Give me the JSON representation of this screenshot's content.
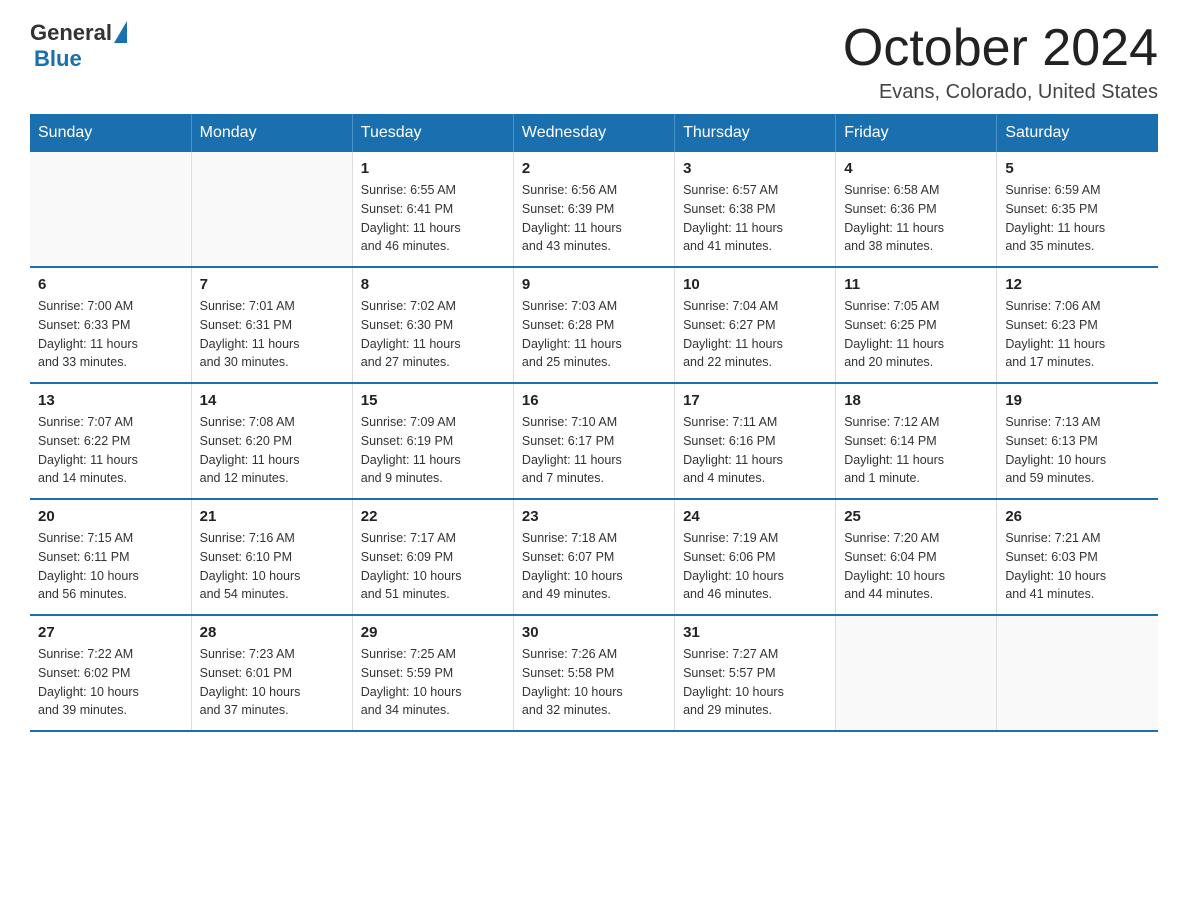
{
  "logo": {
    "general": "General",
    "triangle": "▶",
    "blue": "Blue"
  },
  "header": {
    "title": "October 2024",
    "location": "Evans, Colorado, United States"
  },
  "days_of_week": [
    "Sunday",
    "Monday",
    "Tuesday",
    "Wednesday",
    "Thursday",
    "Friday",
    "Saturday"
  ],
  "weeks": [
    [
      {
        "day": "",
        "info": ""
      },
      {
        "day": "",
        "info": ""
      },
      {
        "day": "1",
        "info": "Sunrise: 6:55 AM\nSunset: 6:41 PM\nDaylight: 11 hours\nand 46 minutes."
      },
      {
        "day": "2",
        "info": "Sunrise: 6:56 AM\nSunset: 6:39 PM\nDaylight: 11 hours\nand 43 minutes."
      },
      {
        "day": "3",
        "info": "Sunrise: 6:57 AM\nSunset: 6:38 PM\nDaylight: 11 hours\nand 41 minutes."
      },
      {
        "day": "4",
        "info": "Sunrise: 6:58 AM\nSunset: 6:36 PM\nDaylight: 11 hours\nand 38 minutes."
      },
      {
        "day": "5",
        "info": "Sunrise: 6:59 AM\nSunset: 6:35 PM\nDaylight: 11 hours\nand 35 minutes."
      }
    ],
    [
      {
        "day": "6",
        "info": "Sunrise: 7:00 AM\nSunset: 6:33 PM\nDaylight: 11 hours\nand 33 minutes."
      },
      {
        "day": "7",
        "info": "Sunrise: 7:01 AM\nSunset: 6:31 PM\nDaylight: 11 hours\nand 30 minutes."
      },
      {
        "day": "8",
        "info": "Sunrise: 7:02 AM\nSunset: 6:30 PM\nDaylight: 11 hours\nand 27 minutes."
      },
      {
        "day": "9",
        "info": "Sunrise: 7:03 AM\nSunset: 6:28 PM\nDaylight: 11 hours\nand 25 minutes."
      },
      {
        "day": "10",
        "info": "Sunrise: 7:04 AM\nSunset: 6:27 PM\nDaylight: 11 hours\nand 22 minutes."
      },
      {
        "day": "11",
        "info": "Sunrise: 7:05 AM\nSunset: 6:25 PM\nDaylight: 11 hours\nand 20 minutes."
      },
      {
        "day": "12",
        "info": "Sunrise: 7:06 AM\nSunset: 6:23 PM\nDaylight: 11 hours\nand 17 minutes."
      }
    ],
    [
      {
        "day": "13",
        "info": "Sunrise: 7:07 AM\nSunset: 6:22 PM\nDaylight: 11 hours\nand 14 minutes."
      },
      {
        "day": "14",
        "info": "Sunrise: 7:08 AM\nSunset: 6:20 PM\nDaylight: 11 hours\nand 12 minutes."
      },
      {
        "day": "15",
        "info": "Sunrise: 7:09 AM\nSunset: 6:19 PM\nDaylight: 11 hours\nand 9 minutes."
      },
      {
        "day": "16",
        "info": "Sunrise: 7:10 AM\nSunset: 6:17 PM\nDaylight: 11 hours\nand 7 minutes."
      },
      {
        "day": "17",
        "info": "Sunrise: 7:11 AM\nSunset: 6:16 PM\nDaylight: 11 hours\nand 4 minutes."
      },
      {
        "day": "18",
        "info": "Sunrise: 7:12 AM\nSunset: 6:14 PM\nDaylight: 11 hours\nand 1 minute."
      },
      {
        "day": "19",
        "info": "Sunrise: 7:13 AM\nSunset: 6:13 PM\nDaylight: 10 hours\nand 59 minutes."
      }
    ],
    [
      {
        "day": "20",
        "info": "Sunrise: 7:15 AM\nSunset: 6:11 PM\nDaylight: 10 hours\nand 56 minutes."
      },
      {
        "day": "21",
        "info": "Sunrise: 7:16 AM\nSunset: 6:10 PM\nDaylight: 10 hours\nand 54 minutes."
      },
      {
        "day": "22",
        "info": "Sunrise: 7:17 AM\nSunset: 6:09 PM\nDaylight: 10 hours\nand 51 minutes."
      },
      {
        "day": "23",
        "info": "Sunrise: 7:18 AM\nSunset: 6:07 PM\nDaylight: 10 hours\nand 49 minutes."
      },
      {
        "day": "24",
        "info": "Sunrise: 7:19 AM\nSunset: 6:06 PM\nDaylight: 10 hours\nand 46 minutes."
      },
      {
        "day": "25",
        "info": "Sunrise: 7:20 AM\nSunset: 6:04 PM\nDaylight: 10 hours\nand 44 minutes."
      },
      {
        "day": "26",
        "info": "Sunrise: 7:21 AM\nSunset: 6:03 PM\nDaylight: 10 hours\nand 41 minutes."
      }
    ],
    [
      {
        "day": "27",
        "info": "Sunrise: 7:22 AM\nSunset: 6:02 PM\nDaylight: 10 hours\nand 39 minutes."
      },
      {
        "day": "28",
        "info": "Sunrise: 7:23 AM\nSunset: 6:01 PM\nDaylight: 10 hours\nand 37 minutes."
      },
      {
        "day": "29",
        "info": "Sunrise: 7:25 AM\nSunset: 5:59 PM\nDaylight: 10 hours\nand 34 minutes."
      },
      {
        "day": "30",
        "info": "Sunrise: 7:26 AM\nSunset: 5:58 PM\nDaylight: 10 hours\nand 32 minutes."
      },
      {
        "day": "31",
        "info": "Sunrise: 7:27 AM\nSunset: 5:57 PM\nDaylight: 10 hours\nand 29 minutes."
      },
      {
        "day": "",
        "info": ""
      },
      {
        "day": "",
        "info": ""
      }
    ]
  ]
}
